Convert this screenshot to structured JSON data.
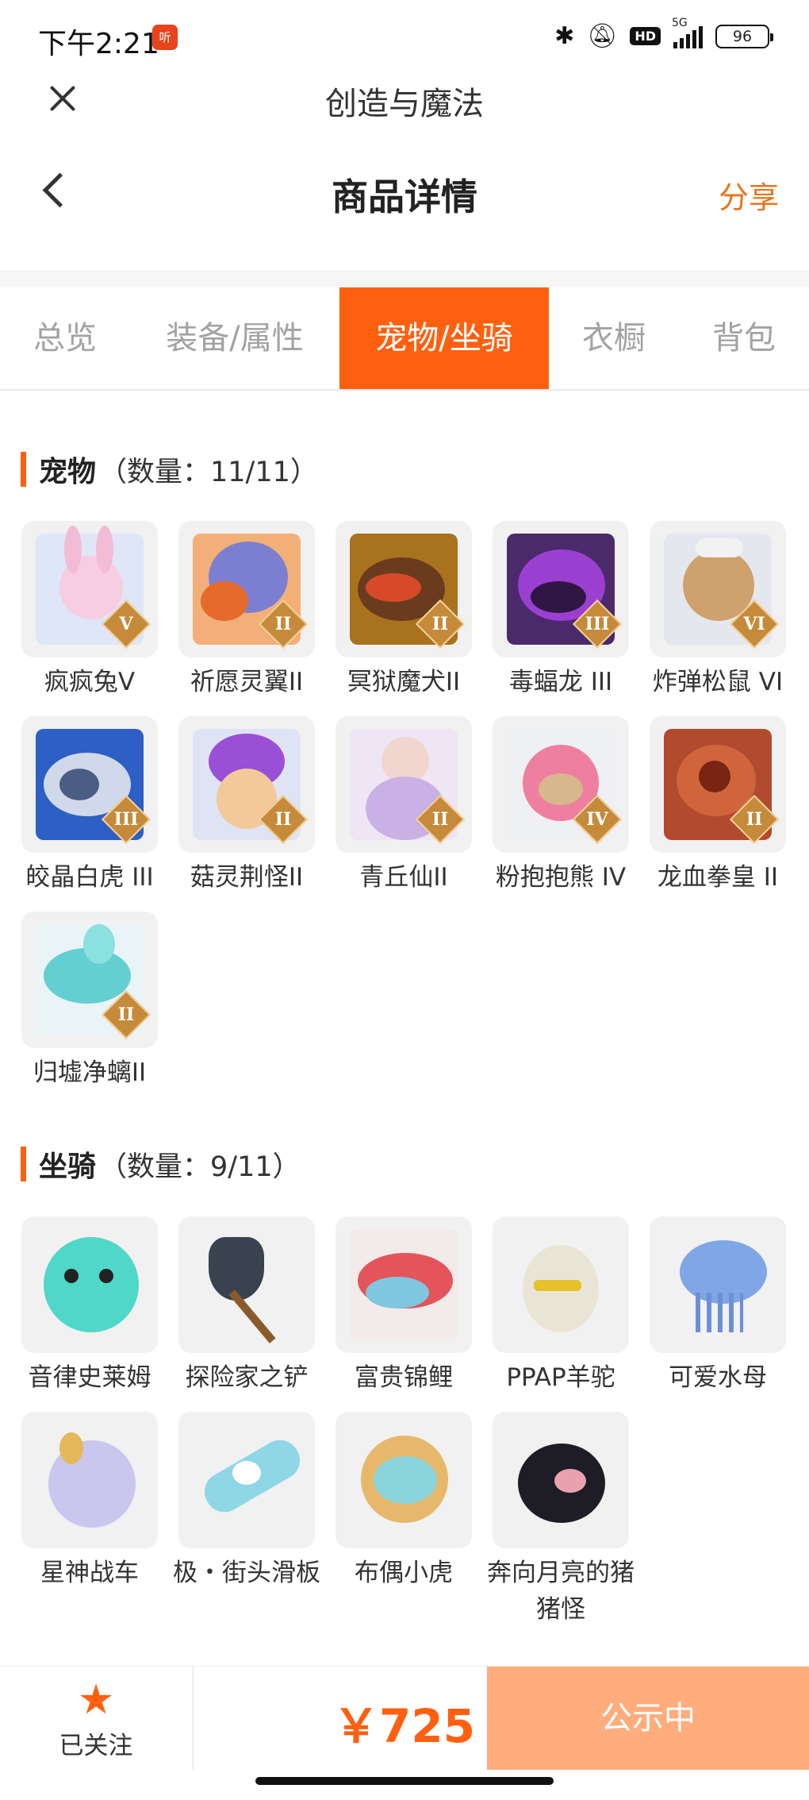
{
  "status_bar": {
    "time": "下午2:21",
    "app_badge": "听",
    "icons": [
      "bluetooth-icon",
      "mute-icon",
      "hd-icon",
      "signal-5g-icon",
      "battery-icon"
    ],
    "hd": "HD",
    "network": "5G",
    "battery": "96"
  },
  "app": {
    "title": "创造与魔法"
  },
  "header": {
    "title": "商品详情",
    "share_label": "分享"
  },
  "colors": {
    "accent": "#ff6010",
    "cta_disabled": "#ffad7c",
    "share": "#e8741c"
  },
  "tabs": [
    {
      "label": "总览",
      "active": false
    },
    {
      "label": "装备/属性",
      "active": false
    },
    {
      "label": "宠物/坐骑",
      "active": true
    },
    {
      "label": "衣橱",
      "active": false
    },
    {
      "label": "背包",
      "active": false
    }
  ],
  "pets": {
    "title": "宠物",
    "count": "（数量：11/11）",
    "items": [
      {
        "name": "疯疯兔V",
        "tier": "V"
      },
      {
        "name": "祈愿灵翼II",
        "tier": "II"
      },
      {
        "name": "冥狱魔犬II",
        "tier": "II"
      },
      {
        "name": "毒蝠龙 III",
        "tier": "III"
      },
      {
        "name": "炸弹松鼠 VI",
        "tier": "VI"
      },
      {
        "name": "皎晶白虎 III",
        "tier": "III"
      },
      {
        "name": "菇灵荆怪II",
        "tier": "II"
      },
      {
        "name": "青丘仙II",
        "tier": "II"
      },
      {
        "name": "粉抱抱熊 IV",
        "tier": "IV"
      },
      {
        "name": "龙血拳皇 II",
        "tier": "II"
      },
      {
        "name": "归墟净螭II",
        "tier": "II"
      }
    ]
  },
  "mounts": {
    "title": "坐骑",
    "count": "（数量：9/11）",
    "items": [
      {
        "name": "音律史莱姆"
      },
      {
        "name": "探险家之铲"
      },
      {
        "name": "富贵锦鲤"
      },
      {
        "name": "PPAP羊驼"
      },
      {
        "name": "可爱水母"
      },
      {
        "name": "星神战车"
      },
      {
        "name": "极・街头滑板"
      },
      {
        "name": "布偶小虎"
      },
      {
        "name": "奔向月亮的猪猪怪"
      }
    ]
  },
  "bottom_bar": {
    "follow_label": "已关注",
    "price": "￥725",
    "cta_label": "公示中"
  }
}
